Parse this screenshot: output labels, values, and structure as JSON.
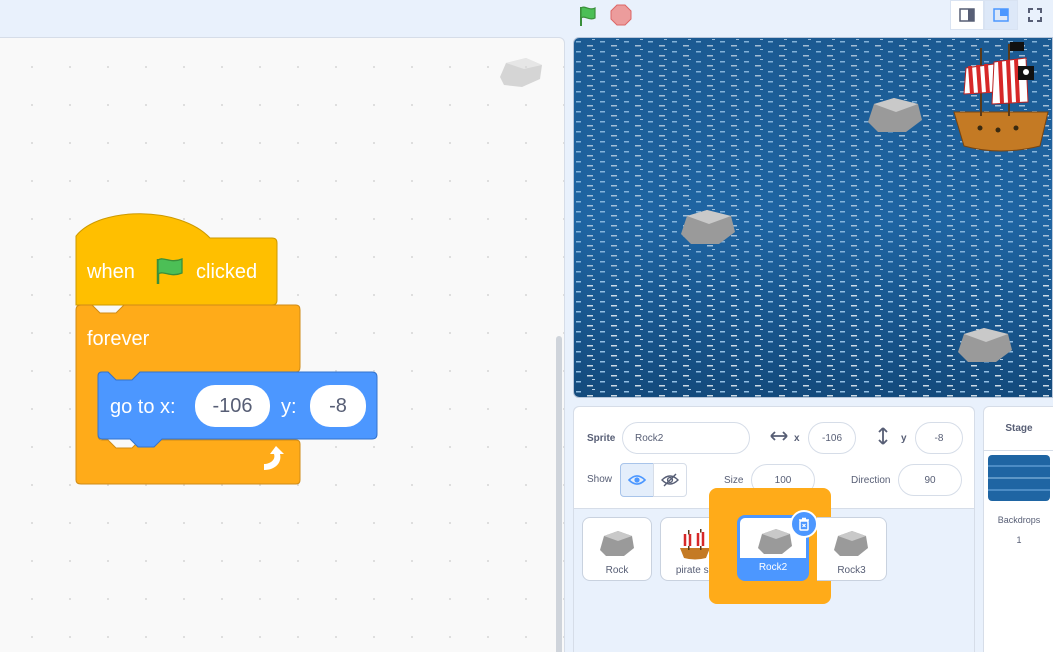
{
  "controls": {
    "green_flag": "green-flag-icon",
    "stop": "stop-sign-icon"
  },
  "blocks": {
    "hat_when": "when",
    "hat_clicked": "clicked",
    "forever": "forever",
    "goto_label": "go to x:",
    "goto_x": "-106",
    "goto_y_label": "y:",
    "goto_y": "-8"
  },
  "sprite_info": {
    "sprite_label": "Sprite",
    "sprite_name": "Rock2",
    "x_label": "x",
    "x_value": "-106",
    "y_label": "y",
    "y_value": "-8",
    "show_label": "Show",
    "size_label": "Size",
    "size_value": "100",
    "direction_label": "Direction",
    "direction_value": "90"
  },
  "sprites": [
    {
      "name": "Rock"
    },
    {
      "name": "pirate sh"
    },
    {
      "name": "Rock2",
      "selected": true
    },
    {
      "name": "Rock3"
    }
  ],
  "stage_pane": {
    "title": "Stage",
    "backdrops_label": "Backdrops",
    "backdrops_count": "1"
  },
  "colors": {
    "events_yellow": "#ffbf00",
    "control_orange": "#ffab19",
    "motion_blue": "#4c97ff",
    "highlight": "#ffab19"
  }
}
